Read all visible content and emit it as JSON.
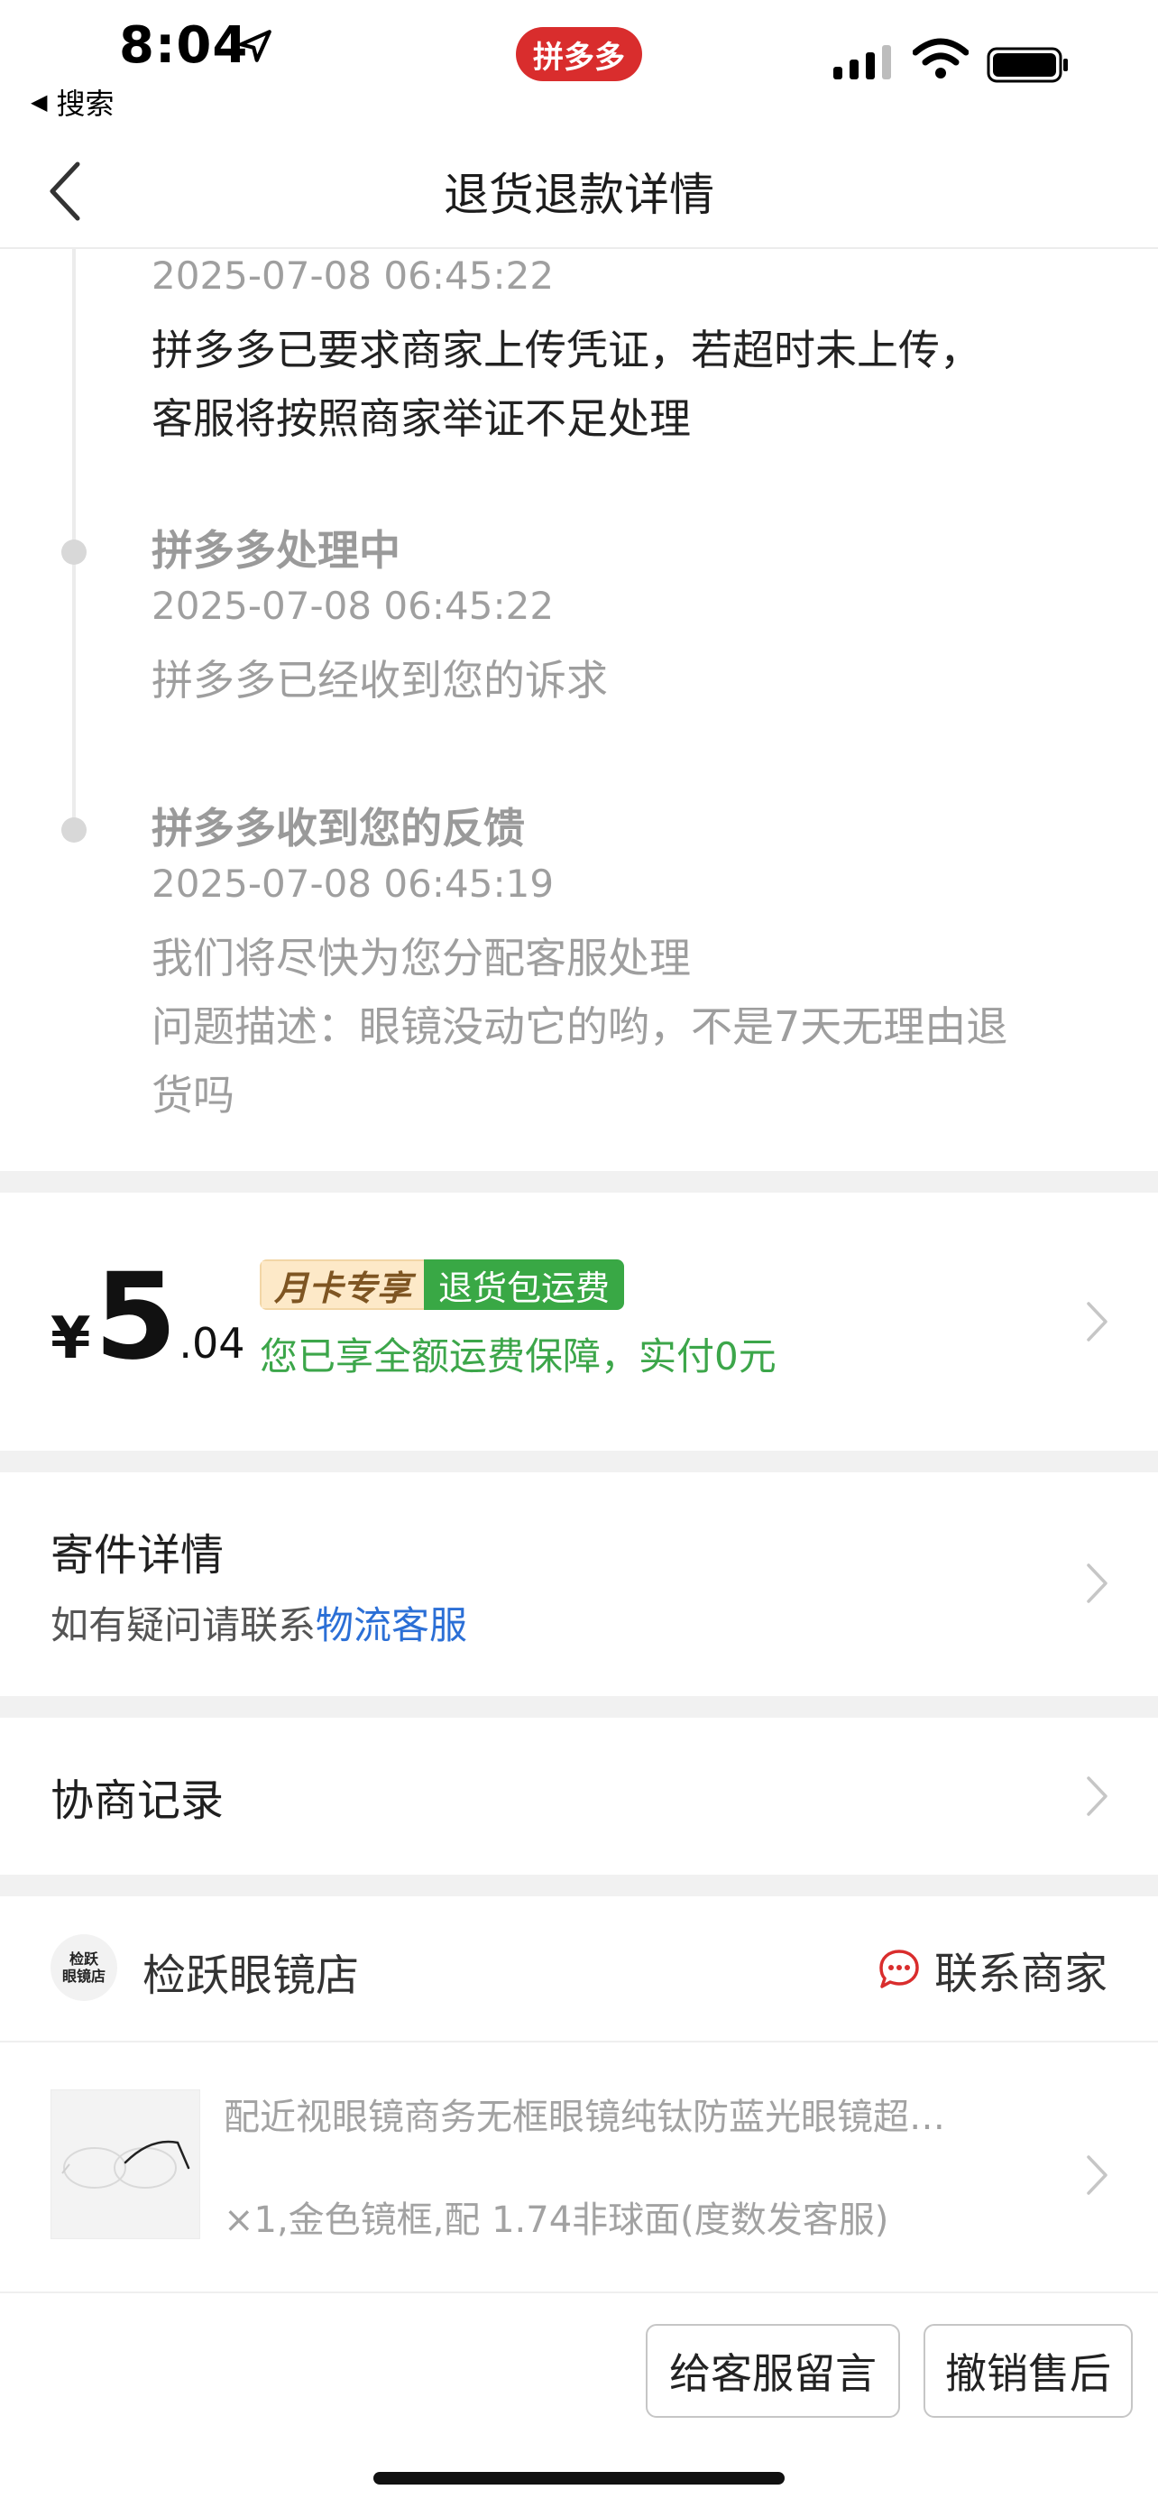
{
  "status_bar": {
    "time": "8:04",
    "back_to_app": "搜索",
    "app_pill": "拼多多"
  },
  "nav": {
    "title": "退货退款详情"
  },
  "timeline": [
    {
      "title": "",
      "time": "2025-07-08 06:45:22",
      "description": [
        "拼多多已要求商家上传凭证，若超时未上传，",
        "客服将按照商家举证不足处理"
      ]
    },
    {
      "title": "拼多多处理中",
      "time": "2025-07-08 06:45:22",
      "description": [
        "拼多多已经收到您的诉求"
      ]
    },
    {
      "title": "拼多多收到您的反馈",
      "time": "2025-07-08 06:45:19",
      "description": [
        "我们将尽快为您分配客服处理",
        "问题描述：眼镜没动它的哟，不是7天无理由退",
        "货吗"
      ]
    }
  ],
  "refund": {
    "currency": "¥",
    "amount_int": "5",
    "amount_frac": ".04",
    "badge_monthly": "月卡专享",
    "badge_return": "退货包运费",
    "note": "您已享全额运费保障，实付0元"
  },
  "shipping": {
    "title": "寄件详情",
    "subtitle_prefix": "如有疑问请联系",
    "subtitle_link": "物流客服"
  },
  "negotiation": {
    "title": "协商记录"
  },
  "store": {
    "logo_line1": "检跃",
    "logo_line2": "眼镜店",
    "name": "检跃眼镜店",
    "contact": "联系商家"
  },
  "product": {
    "title": "配近视眼镜商务无框眼镜纯钛防蓝光眼镜超…",
    "spec": "×1,金色镜框,配 1.74非球面(度数发客服)"
  },
  "actions": {
    "message": "给客服留言",
    "cancel": "撤销售后"
  },
  "colors": {
    "accent_red": "#d92d2d",
    "green": "#39a845",
    "link_blue": "#2b6fd6",
    "gray_text": "#9e9e9e"
  }
}
